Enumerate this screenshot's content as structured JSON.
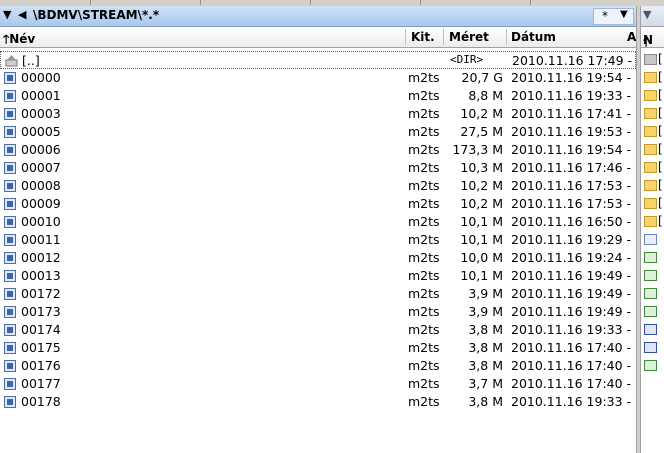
{
  "left_panel": {
    "path": "\\BDMV\\STREAM\\*.*",
    "filter_label": "*",
    "columns": {
      "name": "Név",
      "ext": "Kit.",
      "size": "Méret",
      "date": "Dátum"
    },
    "up_row": {
      "name": "[..]",
      "size": "<DIR>",
      "date": "2010.11.16 17:49 -"
    },
    "files": [
      {
        "name": "00000",
        "ext": "m2ts",
        "size": "20,7 G",
        "date": "2010.11.16 19:54 -"
      },
      {
        "name": "00001",
        "ext": "m2ts",
        "size": "8,8 M",
        "date": "2010.11.16 19:33 -"
      },
      {
        "name": "00003",
        "ext": "m2ts",
        "size": "10,2 M",
        "date": "2010.11.16 17:41 -"
      },
      {
        "name": "00005",
        "ext": "m2ts",
        "size": "27,5 M",
        "date": "2010.11.16 19:53 -"
      },
      {
        "name": "00006",
        "ext": "m2ts",
        "size": "173,3 M",
        "date": "2010.11.16 19:54 -"
      },
      {
        "name": "00007",
        "ext": "m2ts",
        "size": "10,3 M",
        "date": "2010.11.16 17:46 -"
      },
      {
        "name": "00008",
        "ext": "m2ts",
        "size": "10,2 M",
        "date": "2010.11.16 17:53 -"
      },
      {
        "name": "00009",
        "ext": "m2ts",
        "size": "10,2 M",
        "date": "2010.11.16 17:53 -"
      },
      {
        "name": "00010",
        "ext": "m2ts",
        "size": "10,1 M",
        "date": "2010.11.16 16:50 -"
      },
      {
        "name": "00011",
        "ext": "m2ts",
        "size": "10,1 M",
        "date": "2010.11.16 19:29 -"
      },
      {
        "name": "00012",
        "ext": "m2ts",
        "size": "10,0 M",
        "date": "2010.11.16 19:24 -"
      },
      {
        "name": "00013",
        "ext": "m2ts",
        "size": "10,1 M",
        "date": "2010.11.16 19:49 -"
      },
      {
        "name": "00172",
        "ext": "m2ts",
        "size": "3,9 M",
        "date": "2010.11.16 19:49 -"
      },
      {
        "name": "00173",
        "ext": "m2ts",
        "size": "3,9 M",
        "date": "2010.11.16 19:49 -"
      },
      {
        "name": "00174",
        "ext": "m2ts",
        "size": "3,8 M",
        "date": "2010.11.16 19:33 -"
      },
      {
        "name": "00175",
        "ext": "m2ts",
        "size": "3,8 M",
        "date": "2010.11.16 17:40 -"
      },
      {
        "name": "00176",
        "ext": "m2ts",
        "size": "3,8 M",
        "date": "2010.11.16 17:40 -"
      },
      {
        "name": "00177",
        "ext": "m2ts",
        "size": "3,7 M",
        "date": "2010.11.16 17:40 -"
      },
      {
        "name": "00178",
        "ext": "m2ts",
        "size": "3,8 M",
        "date": "2010.11.16 19:33 -"
      }
    ]
  },
  "right_panel": {
    "header_name": "N",
    "items": [
      {
        "icon": "up-folder-icon",
        "type": "up",
        "label": "["
      },
      {
        "icon": "folder-icon",
        "type": "folder",
        "label": "["
      },
      {
        "icon": "folder-icon",
        "type": "folder",
        "label": "["
      },
      {
        "icon": "folder-icon",
        "type": "folder",
        "label": "["
      },
      {
        "icon": "folder-icon",
        "type": "folder",
        "label": "["
      },
      {
        "icon": "folder-icon",
        "type": "folder",
        "label": "["
      },
      {
        "icon": "folder-icon",
        "type": "folder",
        "label": "["
      },
      {
        "icon": "folder-icon",
        "type": "folder",
        "label": "["
      },
      {
        "icon": "folder-icon",
        "type": "folder",
        "label": "["
      },
      {
        "icon": "folder-icon",
        "type": "folder",
        "label": "["
      },
      {
        "icon": "file-icon",
        "type": "doc",
        "label": ""
      },
      {
        "icon": "spreadsheet-icon",
        "type": "xls",
        "label": ""
      },
      {
        "icon": "spreadsheet-icon",
        "type": "xls",
        "label": ""
      },
      {
        "icon": "spreadsheet-icon",
        "type": "xls",
        "label": ""
      },
      {
        "icon": "spreadsheet-icon",
        "type": "xls",
        "label": ""
      },
      {
        "icon": "word-document-icon",
        "type": "word",
        "label": ""
      },
      {
        "icon": "word-document-icon",
        "type": "word",
        "label": ""
      },
      {
        "icon": "spreadsheet-icon",
        "type": "xls",
        "label": ""
      }
    ]
  }
}
